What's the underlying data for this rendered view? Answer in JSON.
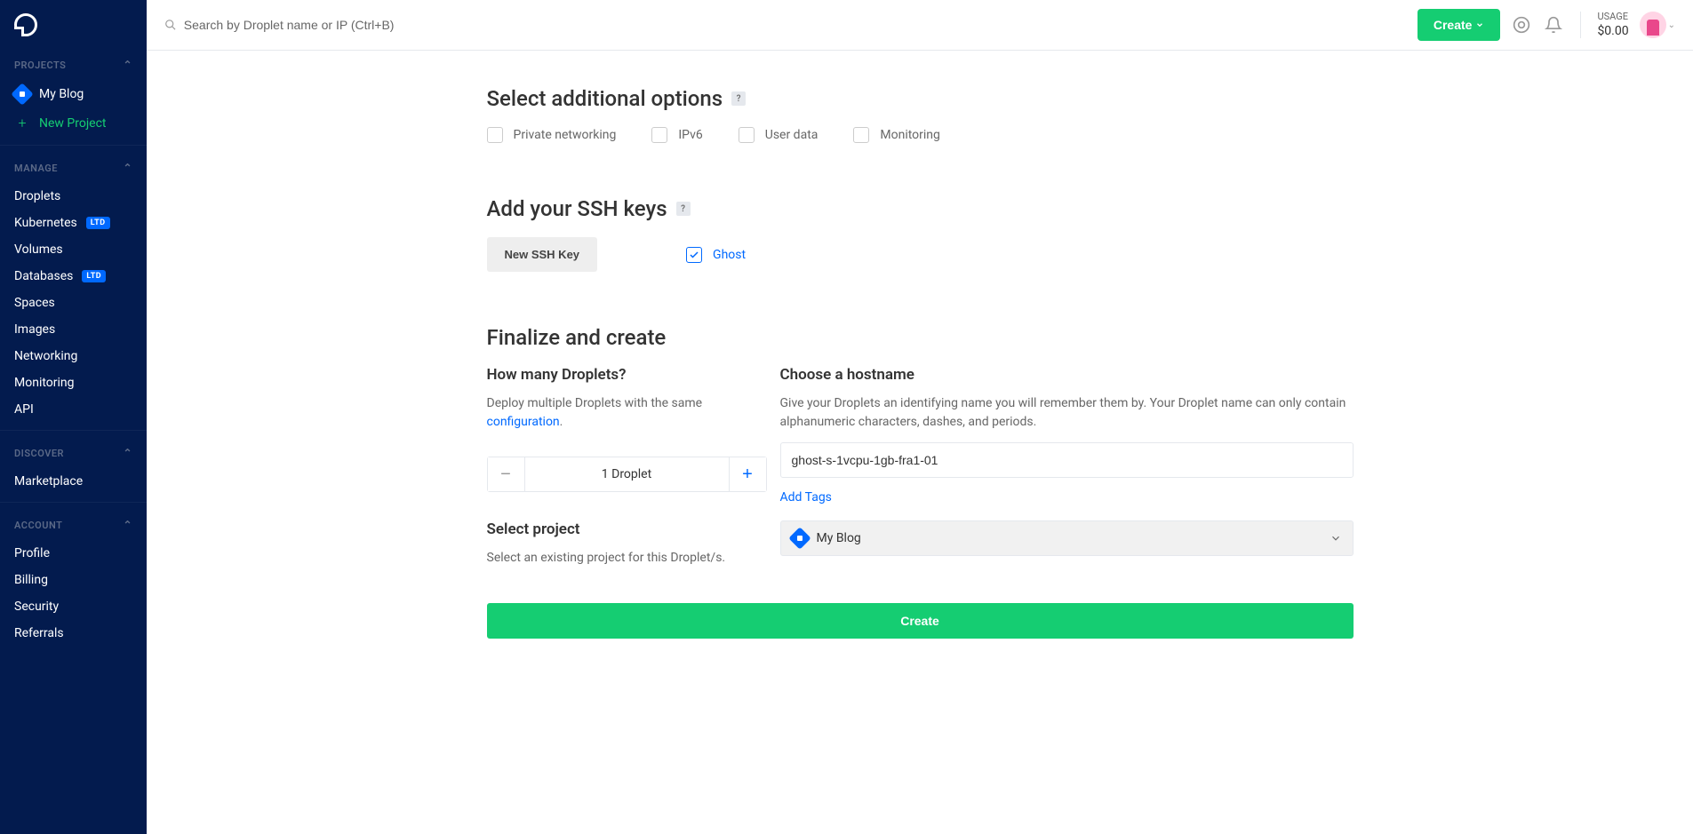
{
  "topbar": {
    "search_placeholder": "Search by Droplet name or IP (Ctrl+B)",
    "create_button": "Create",
    "usage_label": "USAGE",
    "usage_amount": "$0.00"
  },
  "sidebar": {
    "sections": {
      "projects": "PROJECTS",
      "manage": "MANAGE",
      "discover": "DISCOVER",
      "account": "ACCOUNT"
    },
    "project_name": "My Blog",
    "new_project": "New Project",
    "manage_items": [
      {
        "label": "Droplets",
        "badge": ""
      },
      {
        "label": "Kubernetes",
        "badge": "LTD"
      },
      {
        "label": "Volumes",
        "badge": ""
      },
      {
        "label": "Databases",
        "badge": "LTD"
      },
      {
        "label": "Spaces",
        "badge": ""
      },
      {
        "label": "Images",
        "badge": ""
      },
      {
        "label": "Networking",
        "badge": ""
      },
      {
        "label": "Monitoring",
        "badge": ""
      },
      {
        "label": "API",
        "badge": ""
      }
    ],
    "discover_items": [
      {
        "label": "Marketplace"
      }
    ],
    "account_items": [
      {
        "label": "Profile"
      },
      {
        "label": "Billing"
      },
      {
        "label": "Security"
      },
      {
        "label": "Referrals"
      }
    ]
  },
  "content": {
    "additional": {
      "title": "Select additional options",
      "options": [
        "Private networking",
        "IPv6",
        "User data",
        "Monitoring"
      ]
    },
    "ssh": {
      "title": "Add your SSH keys",
      "new_button": "New SSH Key",
      "keys": [
        {
          "name": "Ghost",
          "checked": true
        }
      ]
    },
    "finalize": {
      "title": "Finalize and create",
      "droplets_title": "How many Droplets?",
      "droplets_help_prefix": "Deploy multiple Droplets with the same ",
      "droplets_help_link": "configuration",
      "droplets_count": "1 Droplet",
      "hostname_title": "Choose a hostname",
      "hostname_help": "Give your Droplets an identifying name you will remember them by. Your Droplet name can only contain alphanumeric characters, dashes, and periods.",
      "hostname_value": "ghost-s-1vcpu-1gb-fra1-01",
      "add_tags": "Add Tags",
      "project_title": "Select project",
      "project_help": "Select an existing project for this Droplet/s.",
      "project_value": "My Blog",
      "create_button": "Create"
    }
  }
}
